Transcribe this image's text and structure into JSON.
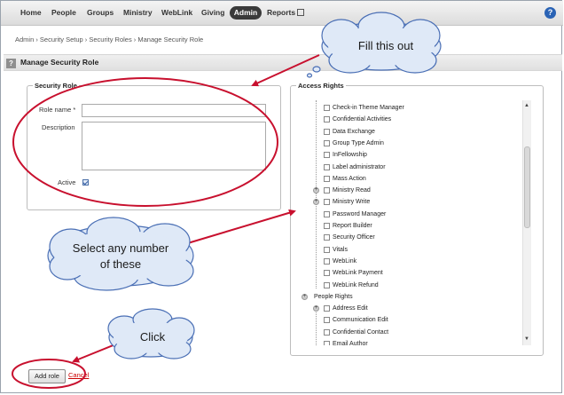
{
  "nav": {
    "items": [
      "Home",
      "People",
      "Groups",
      "Ministry",
      "WebLink",
      "Giving",
      "Admin",
      "Reports"
    ],
    "active": "Admin",
    "help_icon": "?"
  },
  "breadcrumb": "Admin › Security Setup › Security Roles › Manage Security Role",
  "page_title": "Manage Security Role",
  "section_icon": "?",
  "security_role": {
    "legend": "Security Role",
    "role_name_label": "Role name *",
    "role_name_value": "",
    "description_label": "Description",
    "description_value": "",
    "active_label": "Active",
    "active_checked": true
  },
  "access_rights": {
    "legend": "Access Rights",
    "items": [
      {
        "label": "Check-in Theme Manager",
        "expander": false,
        "indent": 1
      },
      {
        "label": "Confidential Activities",
        "expander": false,
        "indent": 1
      },
      {
        "label": "Data Exchange",
        "expander": false,
        "indent": 1
      },
      {
        "label": "Group Type Admin",
        "expander": false,
        "indent": 1
      },
      {
        "label": "InFellowship",
        "expander": false,
        "indent": 1
      },
      {
        "label": "Label administrator",
        "expander": false,
        "indent": 1
      },
      {
        "label": "Mass Action",
        "expander": false,
        "indent": 1
      },
      {
        "label": "Ministry Read",
        "expander": true,
        "indent": 1
      },
      {
        "label": "Ministry Write",
        "expander": true,
        "indent": 1
      },
      {
        "label": "Password Manager",
        "expander": false,
        "indent": 1
      },
      {
        "label": "Report Builder",
        "expander": false,
        "indent": 1
      },
      {
        "label": "Security Officer",
        "expander": false,
        "indent": 1
      },
      {
        "label": "Vitals",
        "expander": false,
        "indent": 1
      },
      {
        "label": "WebLink",
        "expander": false,
        "indent": 1
      },
      {
        "label": "WebLink Payment",
        "expander": false,
        "indent": 1
      },
      {
        "label": "WebLink Refund",
        "expander": false,
        "indent": 1
      },
      {
        "label": "People Rights",
        "expander": true,
        "indent": 0,
        "group": true
      },
      {
        "label": "Address Edit",
        "expander": true,
        "indent": 1
      },
      {
        "label": "Communication Edit",
        "expander": false,
        "indent": 1
      },
      {
        "label": "Confidential Contact",
        "expander": false,
        "indent": 1
      },
      {
        "label": "Email Author",
        "expander": false,
        "indent": 1
      }
    ]
  },
  "buttons": {
    "add_role": "Add role",
    "cancel": "Cancel"
  },
  "callouts": {
    "fill": "Fill this out",
    "select_line1": "Select any number",
    "select_line2": "of these",
    "click": "Click"
  },
  "colors": {
    "annotation_red": "#c8102e",
    "callout_fill": "#dfe9f7",
    "callout_stroke": "#4a6fb5",
    "link_red": "#cc0000"
  }
}
